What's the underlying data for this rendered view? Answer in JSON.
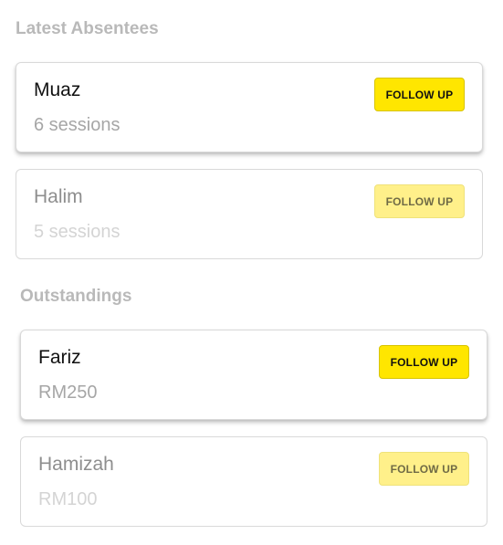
{
  "absentees": {
    "title": "Latest Absentees",
    "items": [
      {
        "name": "Muaz",
        "detail": "6 sessions",
        "button_label": "FOLLOW UP"
      },
      {
        "name": "Halim",
        "detail": "5 sessions",
        "button_label": "FOLLOW UP"
      }
    ]
  },
  "outstandings": {
    "title": "Outstandings",
    "items": [
      {
        "name": "Fariz",
        "detail": "RM250",
        "button_label": "FOLLOW UP"
      },
      {
        "name": "Hamizah",
        "detail": "RM100",
        "button_label": "FOLLOW UP"
      }
    ]
  },
  "colors": {
    "button_yellow": "#ffe600",
    "button_yellow_dim": "#fff08a",
    "section_title_gray": "#b9b9b9"
  }
}
